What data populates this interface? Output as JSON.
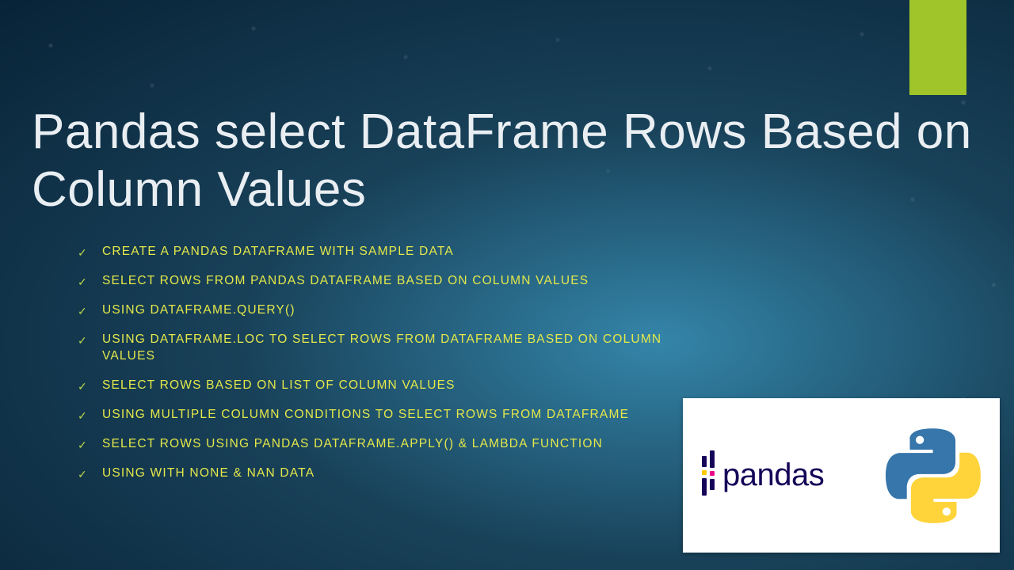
{
  "accent_color": "#9fc52a",
  "title": "Pandas select DataFrame Rows Based on Column Values",
  "bullets": [
    "CREATE A PANDAS DATAFRAME WITH SAMPLE DATA",
    "SELECT ROWS FROM PANDAS DATAFRAME BASED ON COLUMN VALUES",
    "USING DATAFRAME.QUERY()",
    "USING DATAFRAME.LOC TO SELECT ROWS FROM DATAFRAME BASED ON COLUMN VALUES",
    " SELECT ROWS BASED ON LIST OF COLUMN VALUES",
    "USING MULTIPLE COLUMN CONDITIONS TO SELECT ROWS FROM DATAFRAME",
    "SELECT ROWS USING PANDAS DATAFRAME.APPLY() & LAMBDA FUNCTION",
    "USING WITH NONE & NAN DATA"
  ],
  "logo": {
    "pandas_text": "pandas",
    "python_icon": "python-logo-icon"
  }
}
